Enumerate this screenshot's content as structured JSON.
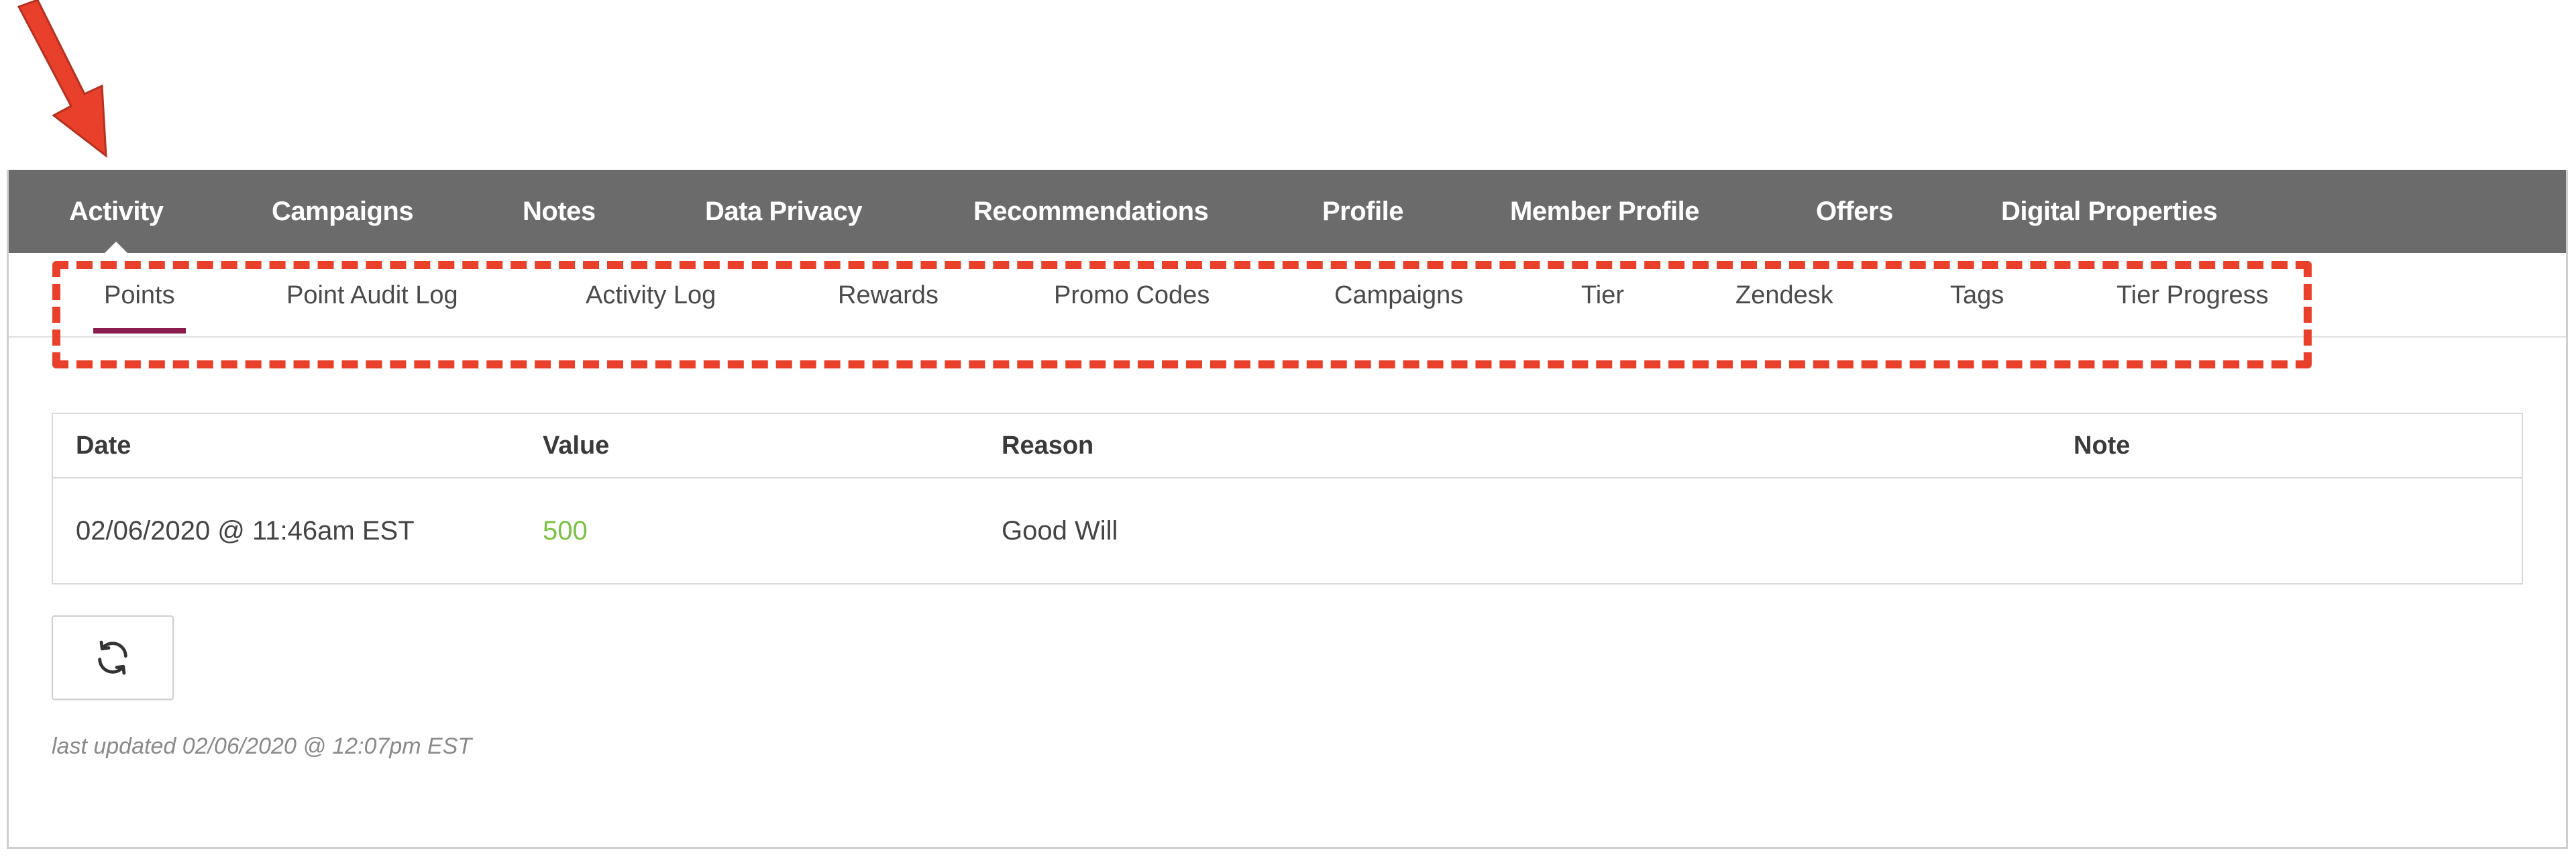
{
  "primary_nav": {
    "tabs": [
      {
        "label": "Activity",
        "active": true
      },
      {
        "label": "Campaigns"
      },
      {
        "label": "Notes"
      },
      {
        "label": "Data Privacy"
      },
      {
        "label": "Recommendations"
      },
      {
        "label": "Profile"
      },
      {
        "label": "Member Profile"
      },
      {
        "label": "Offers"
      },
      {
        "label": "Digital Properties"
      }
    ]
  },
  "secondary_nav": {
    "tabs": [
      {
        "label": "Points",
        "active": true
      },
      {
        "label": "Point Audit Log"
      },
      {
        "label": "Activity Log"
      },
      {
        "label": "Rewards"
      },
      {
        "label": "Promo Codes"
      },
      {
        "label": "Campaigns"
      },
      {
        "label": "Tier"
      },
      {
        "label": "Zendesk"
      },
      {
        "label": "Tags"
      },
      {
        "label": "Tier Progress"
      }
    ]
  },
  "table": {
    "columns": [
      "Date",
      "Value",
      "Reason",
      "Note"
    ],
    "rows": [
      {
        "date": "02/06/2020 @ 11:46am EST",
        "value": "500",
        "reason": "Good Will",
        "note": ""
      }
    ]
  },
  "refresh": {
    "icon": "refresh-icon"
  },
  "footer": {
    "last_updated": "last updated 02/06/2020 @ 12:07pm EST"
  },
  "colors": {
    "nav_background": "#6b6b6b",
    "active_underline": "#8b1d4c",
    "value_green": "#7cc242",
    "annotation_red": "#e8402a"
  }
}
